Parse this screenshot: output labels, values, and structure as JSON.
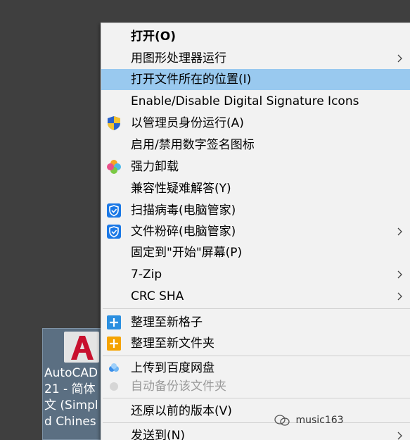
{
  "menu": {
    "items": [
      {
        "label": "打开(O)"
      },
      {
        "label": "用图形处理器运行"
      },
      {
        "label": "打开文件所在的位置(I)"
      },
      {
        "label": "Enable/Disable Digital Signature Icons"
      },
      {
        "label": "以管理员身份运行(A)"
      },
      {
        "label": "启用/禁用数字签名图标"
      },
      {
        "label": "强力卸载"
      },
      {
        "label": "兼容性疑难解答(Y)"
      },
      {
        "label": "扫描病毒(电脑管家)"
      },
      {
        "label": "文件粉碎(电脑管家)"
      },
      {
        "label": "固定到\"开始\"屏幕(P)"
      },
      {
        "label": "7-Zip"
      },
      {
        "label": "CRC SHA"
      },
      {
        "label": "整理至新格子"
      },
      {
        "label": "整理至新文件夹"
      },
      {
        "label": "上传到百度网盘"
      },
      {
        "label": "自动备份该文件夹"
      },
      {
        "label": "还原以前的版本(V)"
      },
      {
        "label": "发送到(N)"
      }
    ]
  },
  "desktop_icon": {
    "label_lines": [
      "AutoCAD",
      "21 - 简体",
      "文 (Simpl",
      "d Chines"
    ]
  },
  "watermark": {
    "text": "music163"
  },
  "colors": {
    "highlight": "#99c9ef",
    "menu_background": "#f2f2f2",
    "desktop_background": "#3f3f3f",
    "tencent_blue": "#1a78e6",
    "autocad_red": "#c8102e"
  }
}
